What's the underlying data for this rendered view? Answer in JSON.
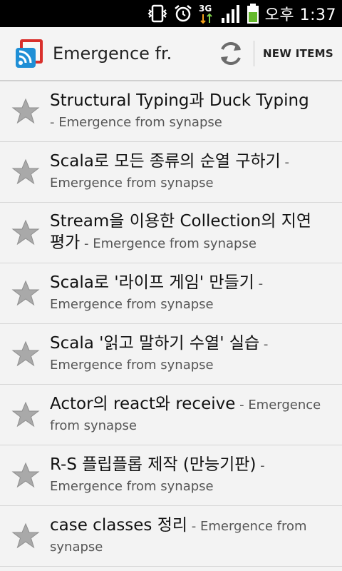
{
  "status": {
    "time": "오후 1:37",
    "network": "3G"
  },
  "header": {
    "title": "Emergence fr.",
    "new_items_label": "NEW ITEMS"
  },
  "items": [
    {
      "title": "Structural Typing과 Duck Typing",
      "source": "- Emergence from synapse"
    },
    {
      "title": "Scala로 모든 종류의 순열 구하기",
      "source": " - Emergence from synapse"
    },
    {
      "title": "Stream을 이용한 Collection의 지연 평가",
      "source": " - Emergence from synapse"
    },
    {
      "title": "Scala로 '라이프 게임' 만들기",
      "source": " - Emergence from synapse"
    },
    {
      "title": "Scala '읽고 말하기 수열' 실습",
      "source": " - Emergence from synapse"
    },
    {
      "title": "Actor의 react와 receive",
      "source": " - Emergence from synapse"
    },
    {
      "title": "R-S 플립플롭 제작 (만능기판)",
      "source": " - Emergence from synapse"
    },
    {
      "title": "case classes 정리",
      "source": " - Emergence from synapse"
    }
  ],
  "colors": {
    "star": "#a9a9a9",
    "rss": "#1f8fd6",
    "red": "#d9302c"
  }
}
